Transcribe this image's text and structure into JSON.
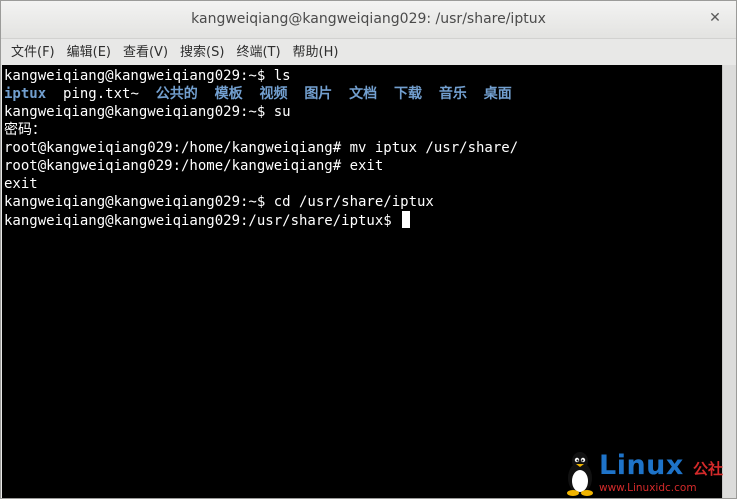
{
  "window": {
    "title": "kangweiqiang@kangweiqiang029: /usr/share/iptux",
    "close_glyph": "✕"
  },
  "menu": {
    "items": [
      "文件(F)",
      "编辑(E)",
      "查看(V)",
      "搜索(S)",
      "终端(T)",
      "帮助(H)"
    ]
  },
  "terminal": {
    "lines": [
      "kangweiqiang@kangweiqiang029:~$ ls",
      null,
      "kangweiqiang@kangweiqiang029:~$ su",
      "密码：",
      "root@kangweiqiang029:/home/kangweiqiang# mv iptux /usr/share/",
      "root@kangweiqiang029:/home/kangweiqiang# exit",
      "exit",
      "kangweiqiang@kangweiqiang029:~$ cd /usr/share/iptux",
      "kangweiqiang@kangweiqiang029:/usr/share/iptux$ "
    ],
    "ls_output": [
      {
        "name": "iptux",
        "kind": "dir"
      },
      {
        "name": "ping.txt~",
        "kind": "file"
      },
      {
        "name": "公共的",
        "kind": "dir"
      },
      {
        "name": "模板",
        "kind": "dir"
      },
      {
        "name": "视频",
        "kind": "dir"
      },
      {
        "name": "图片",
        "kind": "dir"
      },
      {
        "name": "文档",
        "kind": "dir"
      },
      {
        "name": "下载",
        "kind": "dir"
      },
      {
        "name": "音乐",
        "kind": "dir"
      },
      {
        "name": "桌面",
        "kind": "dir"
      }
    ],
    "colors": {
      "background": "#000000",
      "text": "#ffffff",
      "directory": "#729fcf"
    }
  },
  "watermark": {
    "brand": "Linux",
    "brand_cn": "公社",
    "url": "www.Linuxidc.com"
  }
}
